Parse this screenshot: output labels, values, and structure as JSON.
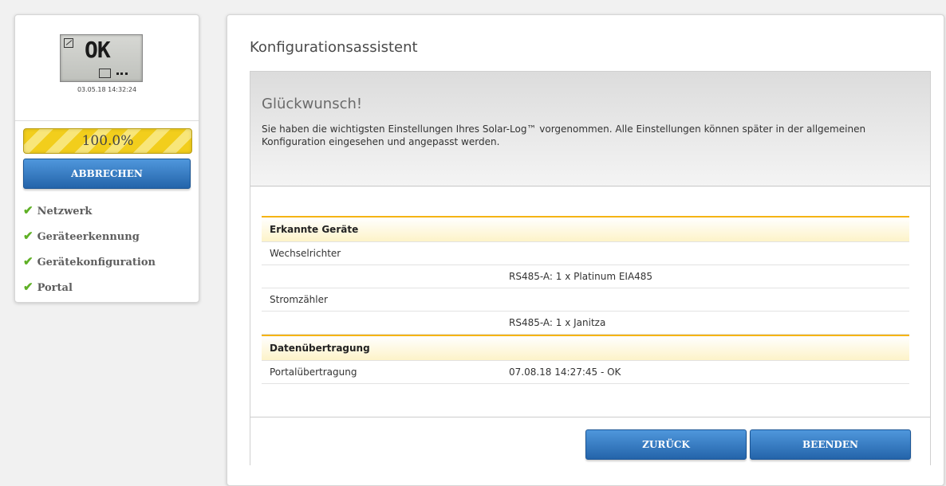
{
  "sidebar": {
    "lcd_text": "OK",
    "timestamp": "03.05.18 14:32:24",
    "progress_value": 1.0,
    "progress_label": "100.0%",
    "cancel_label": "ABBRECHEN",
    "steps": [
      {
        "label": "Netzwerk",
        "done": true
      },
      {
        "label": "Geräteerkennung",
        "done": true
      },
      {
        "label": "Gerätekonfiguration",
        "done": true
      },
      {
        "label": "Portal",
        "done": true
      }
    ],
    "check_icon": "✔"
  },
  "main": {
    "title": "Konfigurationsassistent",
    "heading": "Glückwunsch!",
    "message": "Sie haben die wichtigsten Einstellungen Ihres Solar-Log™ vorgenommen. Alle Einstellungen können später in der allgemeinen Konfiguration eingesehen und angepasst werden.",
    "sections": [
      {
        "header": "Erkannte Geräte",
        "rows": [
          {
            "label": "Wechselrichter",
            "value": ""
          },
          {
            "label": "",
            "value": "RS485-A: 1 x Platinum EIA485"
          },
          {
            "label": "Stromzähler",
            "value": ""
          },
          {
            "label": "",
            "value": "RS485-A: 1 x Janitza"
          }
        ]
      },
      {
        "header": "Datenübertragung",
        "rows": [
          {
            "label": "Portalübertragung",
            "value": "07.08.18 14:27:45 - OK"
          }
        ]
      }
    ],
    "back_label": "ZURÜCK",
    "finish_label": "BEENDEN"
  },
  "colors": {
    "accent_blue": "#2f74c0",
    "progress_yellow": "#f2ce1c",
    "section_border": "#f5b414",
    "check_green": "#5fb025"
  }
}
